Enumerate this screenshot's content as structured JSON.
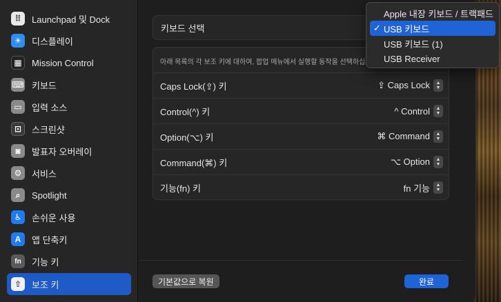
{
  "sidebar": {
    "items": [
      {
        "label": "Launchpad 및 Dock",
        "icon": "launchpad-icon",
        "color": "#e9e9e9",
        "glyph": "⠿",
        "fg": "#555"
      },
      {
        "label": "디스플레이",
        "icon": "display-icon",
        "color": "#2f8cf0",
        "glyph": "☀",
        "fg": "#fff"
      },
      {
        "label": "Mission Control",
        "icon": "mission-control-icon",
        "color": "#222222",
        "glyph": "▦",
        "fg": "#fff"
      },
      {
        "label": "키보드",
        "icon": "keyboard-icon",
        "color": "#8a8a8a",
        "glyph": "⌨",
        "fg": "#fff"
      },
      {
        "label": "입력 소스",
        "icon": "input-sources-icon",
        "color": "#8a8a8a",
        "glyph": "▭",
        "fg": "#fff"
      },
      {
        "label": "스크린샷",
        "icon": "screenshot-icon",
        "color": "#3a3a3a",
        "glyph": "⊡",
        "fg": "#fff"
      },
      {
        "label": "발표자 오버레이",
        "icon": "presenter-overlay-icon",
        "color": "#8a8a8a",
        "glyph": "◙",
        "fg": "#fff"
      },
      {
        "label": "서비스",
        "icon": "services-icon",
        "color": "#8a8a8a",
        "glyph": "⚙",
        "fg": "#fff"
      },
      {
        "label": "Spotlight",
        "icon": "spotlight-icon",
        "color": "#8a8a8a",
        "glyph": "⌕",
        "fg": "#fff"
      },
      {
        "label": "손쉬운 사용",
        "icon": "accessibility-icon",
        "color": "#1f7bf0",
        "glyph": "♿",
        "fg": "#fff"
      },
      {
        "label": "앱 단축키",
        "icon": "app-shortcuts-icon",
        "color": "#1f7bf0",
        "glyph": "A",
        "fg": "#fff"
      },
      {
        "label": "기능 키",
        "icon": "function-keys-icon",
        "color": "#5a5a5a",
        "glyph": "fn",
        "fg": "#fff"
      },
      {
        "label": "보조 키",
        "icon": "modifier-keys-icon",
        "color": "#f0f0f0",
        "glyph": "⇧",
        "fg": "#444",
        "selected": true
      }
    ]
  },
  "main": {
    "keyboard_select_label": "키보드 선택",
    "panel_description": "아래 목록의 각 보조 키에 대하여, 팝업 메뉴에서 실행할 동작을 선택하십시오.",
    "rows": [
      {
        "label": "Caps Lock(⇪) 키",
        "value": "⇪ Caps Lock"
      },
      {
        "label": "Control(^) 키",
        "value": "^ Control"
      },
      {
        "label": "Option(⌥) 키",
        "value": "⌘ Command"
      },
      {
        "label": "Command(⌘) 키",
        "value": "⌥ Option"
      },
      {
        "label": "기능(fn) 키",
        "value": "fn 기능"
      }
    ],
    "restore_button": "기본값으로 복원",
    "done_button": "완료"
  },
  "popup_menu": {
    "items": [
      {
        "label": "Apple 내장 키보드 / 트랙패드",
        "checked": false
      },
      {
        "label": "USB 키보드",
        "checked": true
      },
      {
        "label": "USB 키보드 (1)",
        "checked": false
      },
      {
        "label": "USB Receiver",
        "checked": false
      }
    ],
    "check_glyph": "✓"
  },
  "colors": {
    "accent": "#1f63d6",
    "selection": "#1f5bc6"
  }
}
